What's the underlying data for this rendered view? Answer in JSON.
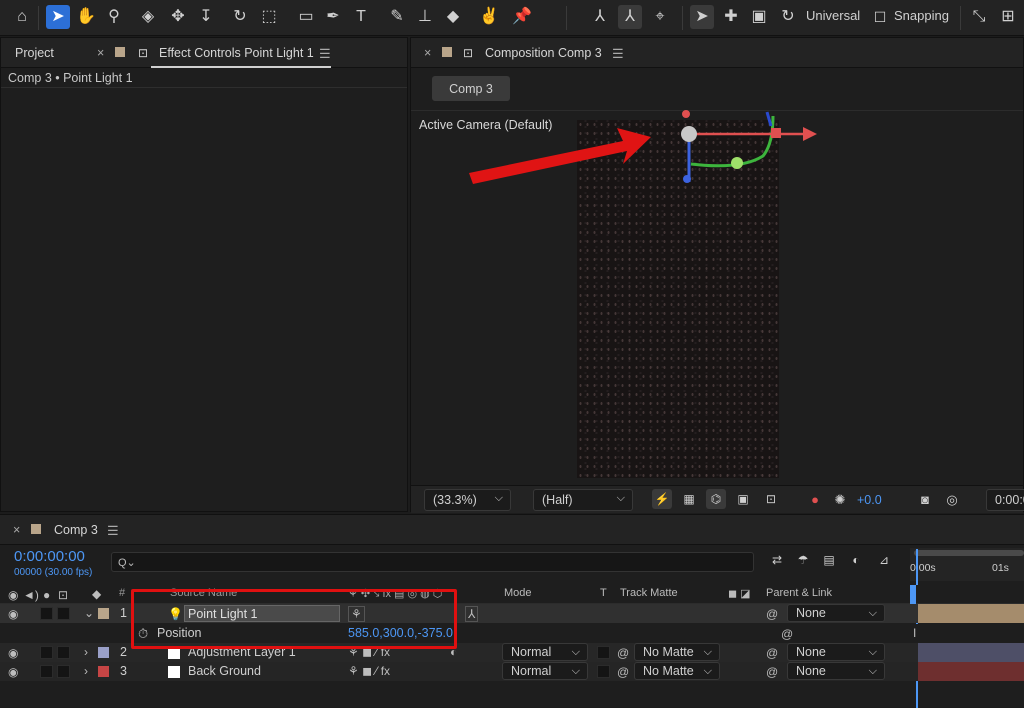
{
  "toolbar": {
    "universal_label": "Universal",
    "snapping_label": "Snapping"
  },
  "left_panel": {
    "project_tab": "Project",
    "effect_tab": "Effect Controls Point Light 1",
    "breadcrumb": "Comp 3 • Point Light 1"
  },
  "comp_panel": {
    "tab_label": "Composition Comp 3",
    "comp_button": "Comp 3",
    "camera_label": "Active Camera (Default)",
    "zoom": "(33.3%)",
    "resolution": "(Half)",
    "exposure": "+0.0",
    "timecode": "0:00:0"
  },
  "timeline": {
    "tab_label": "Comp 3",
    "timecode": "0:00:00:00",
    "frames": "00000 (30.00 fps)",
    "search_glyph": "Q⌄",
    "headers": {
      "number": "#",
      "source_name": "Source Name",
      "mode": "Mode",
      "t": "T",
      "track_matte": "Track Matte",
      "parent_link": "Parent & Link"
    },
    "ruler": {
      "start": "0:00s",
      "mark": "01s"
    },
    "layers": [
      {
        "num": "1",
        "name": "Point Light 1",
        "label_color": "#b9a58a",
        "parent": "None"
      },
      {
        "num": "2",
        "name": "Adjustment Layer 1",
        "label_color": "#9aa0c8",
        "mode": "Normal",
        "matte": "No Matte",
        "parent": "None"
      },
      {
        "num": "3",
        "name": "Back Ground",
        "label_color": "#c64545",
        "mode": "Normal",
        "matte": "No Matte",
        "parent": "None"
      }
    ],
    "position_label": "Position",
    "position_value": "585.0,300.0,-375.0"
  },
  "colors": {
    "accent": "#2c6fd6",
    "highlight": "#e01010",
    "value_blue": "#4d97f5"
  }
}
